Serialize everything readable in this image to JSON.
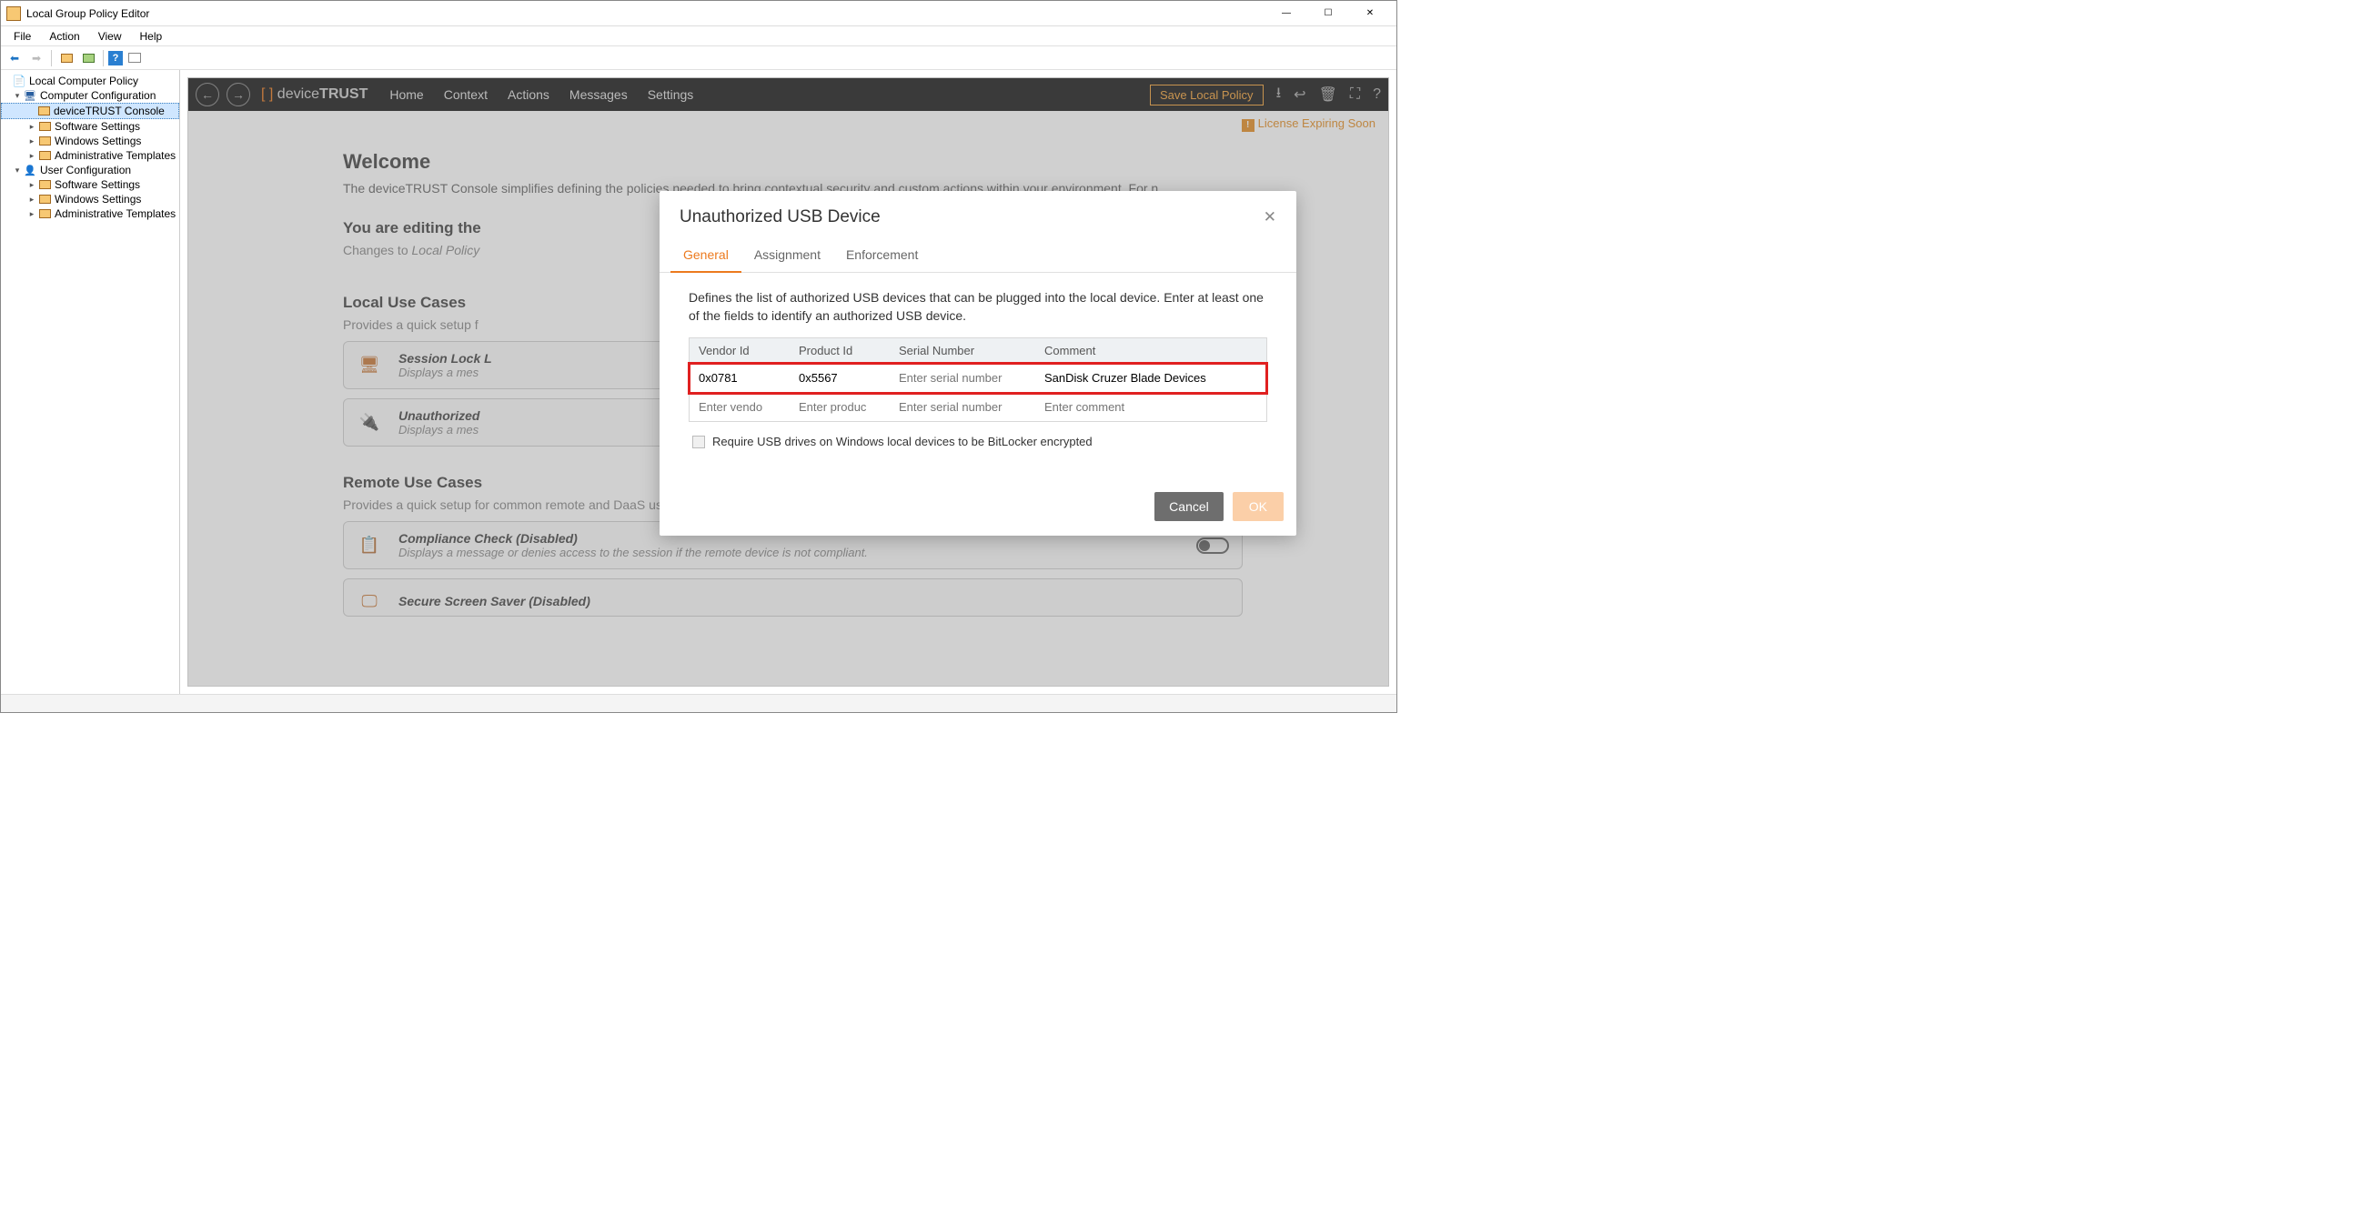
{
  "window": {
    "title": "Local Group Policy Editor"
  },
  "menu": {
    "file": "File",
    "action": "Action",
    "view": "View",
    "help": "Help"
  },
  "tree": {
    "root": "Local Computer Policy",
    "comp": "Computer Configuration",
    "dtconsole": "deviceTRUST Console",
    "soft": "Software Settings",
    "win": "Windows Settings",
    "admin": "Administrative Templates",
    "user": "User Configuration"
  },
  "dt": {
    "logo1": "device",
    "logo2": "TRUST",
    "nav": {
      "home": "Home",
      "context": "Context",
      "actions": "Actions",
      "messages": "Messages",
      "settings": "Settings"
    },
    "save": "Save Local Policy",
    "license": "License Expiring Soon"
  },
  "welcome": {
    "h1": "Welcome",
    "sub": "The deviceTRUST Console simplifies defining the policies needed to bring contextual security and custom actions within your environment. For n",
    "editing_h": "You are editing the",
    "editing_p_a": "Changes to ",
    "editing_p_b": "Local Policy",
    "local_h": "Local Use Cases",
    "local_p": "Provides a quick setup f",
    "uc1_t": "Session Lock L",
    "uc1_d": "Displays a mes",
    "uc2_t": "Unauthorized",
    "uc2_d": "Displays a mes",
    "remote_h": "Remote Use Cases",
    "remote_p": "Provides a quick setup for common remote and DaaS use cases.",
    "uc3_t": "Compliance Check (Disabled)",
    "uc3_d": "Displays a message or denies access to the session if the remote device is not compliant.",
    "uc4_t": "Secure Screen Saver (Disabled)"
  },
  "modal": {
    "title": "Unauthorized USB Device",
    "tabs": {
      "general": "General",
      "assignment": "Assignment",
      "enforcement": "Enforcement"
    },
    "desc": "Defines the list of authorized USB devices that can be plugged into the local device. Enter at least one of the fields to identify an authorized USB device.",
    "headers": {
      "vendor": "Vendor Id",
      "product": "Product Id",
      "serial": "Serial Number",
      "comment": "Comment"
    },
    "row1": {
      "vendor": "0x0781",
      "product": "0x5567",
      "serial_ph": "Enter serial number",
      "comment": "SanDisk Cruzer Blade Devices"
    },
    "row2": {
      "vendor_ph": "Enter vendo",
      "product_ph": "Enter produc",
      "serial_ph": "Enter serial number",
      "comment_ph": "Enter comment"
    },
    "bitlocker": "Require USB drives on Windows local devices to be BitLocker encrypted",
    "cancel": "Cancel",
    "ok": "OK"
  }
}
